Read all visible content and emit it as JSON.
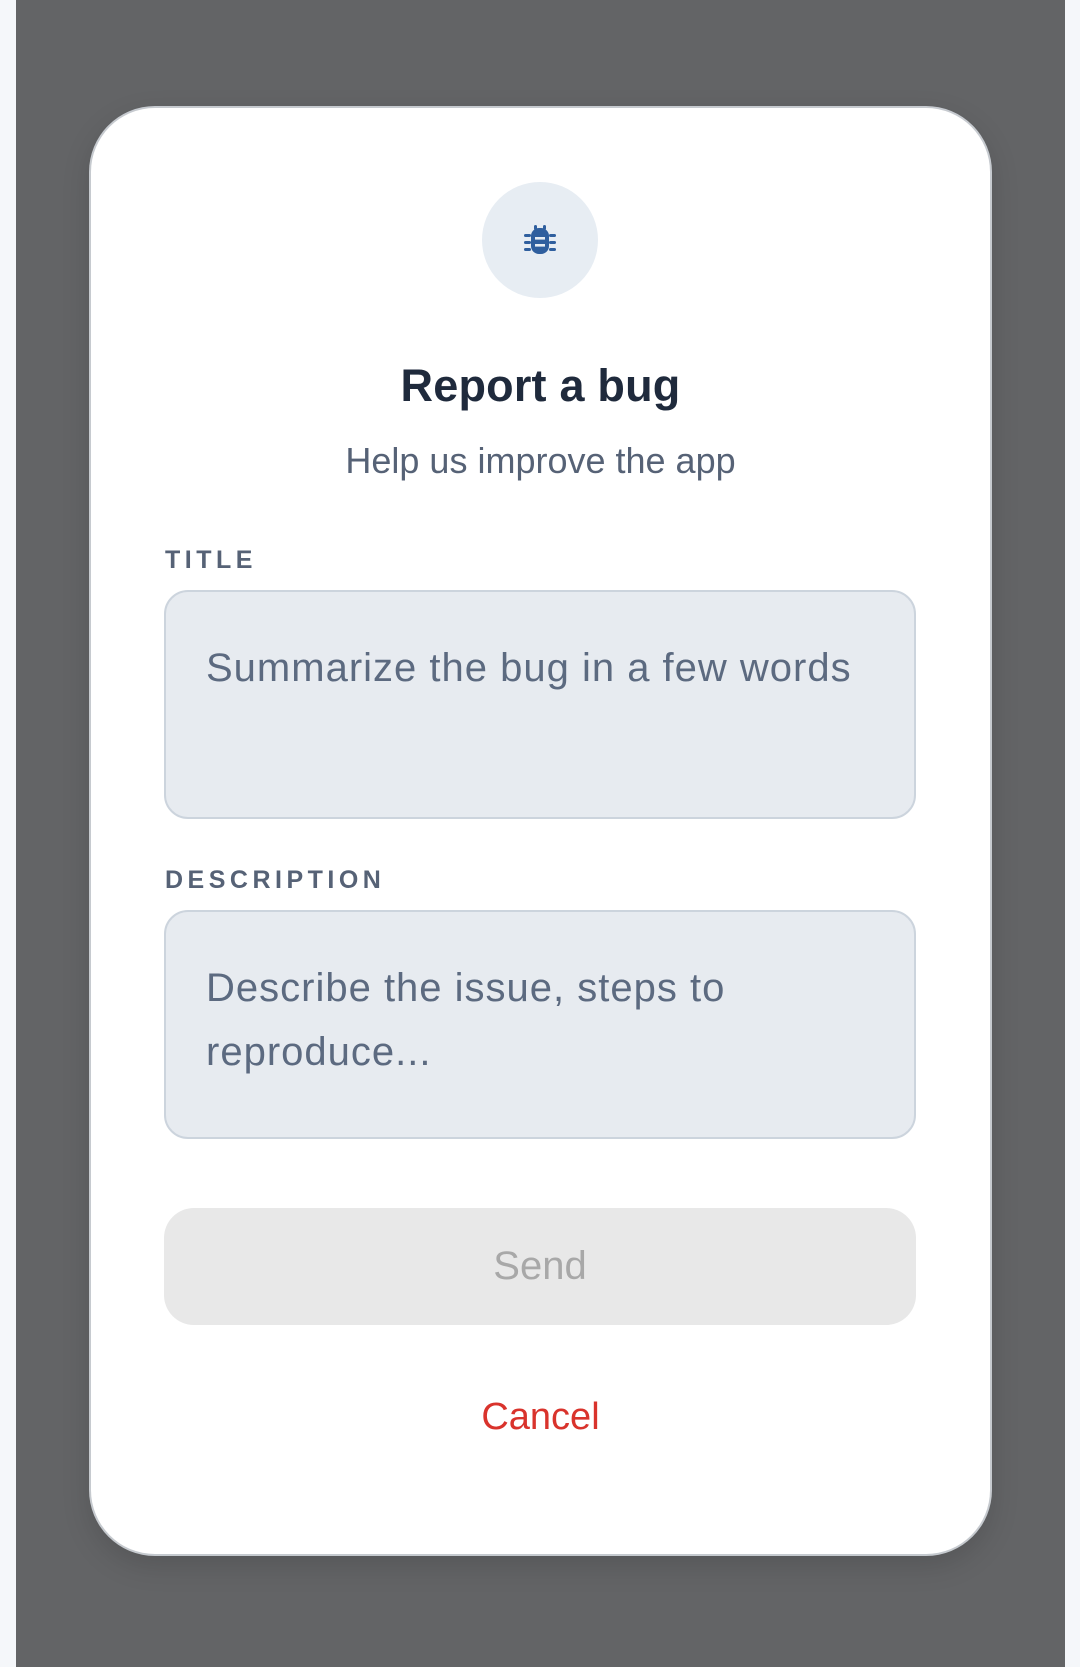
{
  "dialog": {
    "icon": "bug-icon",
    "title": "Report a bug",
    "subtitle": "Help us improve the app",
    "title_field": {
      "label": "TITLE",
      "placeholder": "Summarize the bug in a few words"
    },
    "description_field": {
      "label": "DESCRIPTION",
      "placeholder": "Describe the issue, steps to reproduce..."
    },
    "send_label": "Send",
    "cancel_label": "Cancel"
  },
  "colors": {
    "accent": "#2f5f9e",
    "cancel": "#d9332c",
    "scrim": "#636466"
  }
}
